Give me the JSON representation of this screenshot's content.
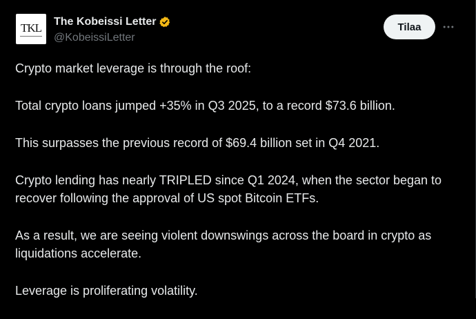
{
  "header": {
    "avatar_text": "TKL",
    "display_name": "The Kobeissi Letter",
    "handle": "@KobeissiLetter",
    "follow_label": "Tilaa",
    "more_icon": "more-horizontal-icon",
    "verified_icon": "verified-badge-icon",
    "verified_color": "#f4b916"
  },
  "tweet": {
    "paragraphs": [
      "Crypto market leverage is through the roof:",
      "Total crypto loans jumped +35% in Q3 2025, to a record $73.6 billion.",
      "This surpasses the previous record of $69.4 billion set in Q4 2021.",
      "Crypto lending has nearly TRIPLED since Q1 2024, when the sector began to recover following the approval of US spot Bitcoin ETFs.",
      "As a result, we are seeing violent downswings across the board in crypto as liquidations accelerate.",
      "Leverage is proliferating volatility."
    ]
  },
  "colors": {
    "background": "#000000",
    "text": "#e7e9ea",
    "secondary_text": "#71767b",
    "button_bg": "#eff3f4"
  }
}
